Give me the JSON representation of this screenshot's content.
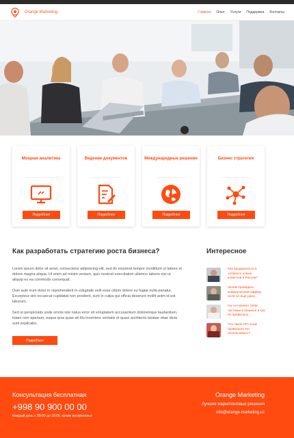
{
  "header": {
    "logo_text": "Orange Marketing",
    "nav": [
      "Главная",
      "Опыт",
      "Услуги",
      "Поддержка",
      "Контакты"
    ]
  },
  "cards": [
    {
      "title": "Мощная аналитика",
      "icon": "monitor-chart-icon",
      "button": "Подробнее"
    },
    {
      "title": "Ведение документов",
      "icon": "document-pen-icon",
      "button": "Подробнее"
    },
    {
      "title": "Международные решения",
      "icon": "globe-icon",
      "button": "Подробнее"
    },
    {
      "title": "Бизнес стратегии",
      "icon": "network-icon",
      "button": "Подробнее"
    }
  ],
  "article": {
    "title": "Как разработать стратегию роста бизнеса?",
    "paragraphs": [
      "Lorem ipsum dolor sit amet, consectetur adipisicing elit, sed do eiusmod tempor incididunt ut labore et dolore magna aliqua. Ut enim ad minim veniam, quis nostrud exercitation ullamco laboris nisi ut aliquip ex ea commodo consequat.",
      "Duis aute irure dolor in reprehenderit in voluptate velit esse cillum dolore eu fugiat nulla pariatur. Excepteur sint occaecat cupidatat non proident, sunt in culpa qui officia deserunt mollit anim id est laborum.",
      "Sed ut perspiciatis unde omnis iste natus error sit voluptatem accusantium doloremque laudantium, totam rem aperiam, eaque ipsa quae ab illo inventore veritatis et quasi architecto beatae vitae dicta sunt explicabo."
    ],
    "button": "Подробнее"
  },
  "aside": {
    "title": "Интересное",
    "items": [
      "Как продвигаться в сегменте новых клиентов в России?",
      "Зачем проводить коммерческий оффер, если он еще рано...",
      "На что влияет CRM системы в бизнесе и как ее правильно ...",
      "Что такое KPI и как правильно его использовать?"
    ]
  },
  "footer": {
    "consult": "Консультация бесплатная",
    "phone": "+998 90 900 00 00",
    "hours": "Каждый день с 09:00 до 18:00, кроме воскресенья",
    "brand": "Orange Marketing",
    "tagline": "Лучшие маркетинговые решения",
    "email": "info@orange-marketing.uz"
  },
  "colors": {
    "accent": "#ff4a10",
    "footer_bg": "#ff4a10"
  }
}
